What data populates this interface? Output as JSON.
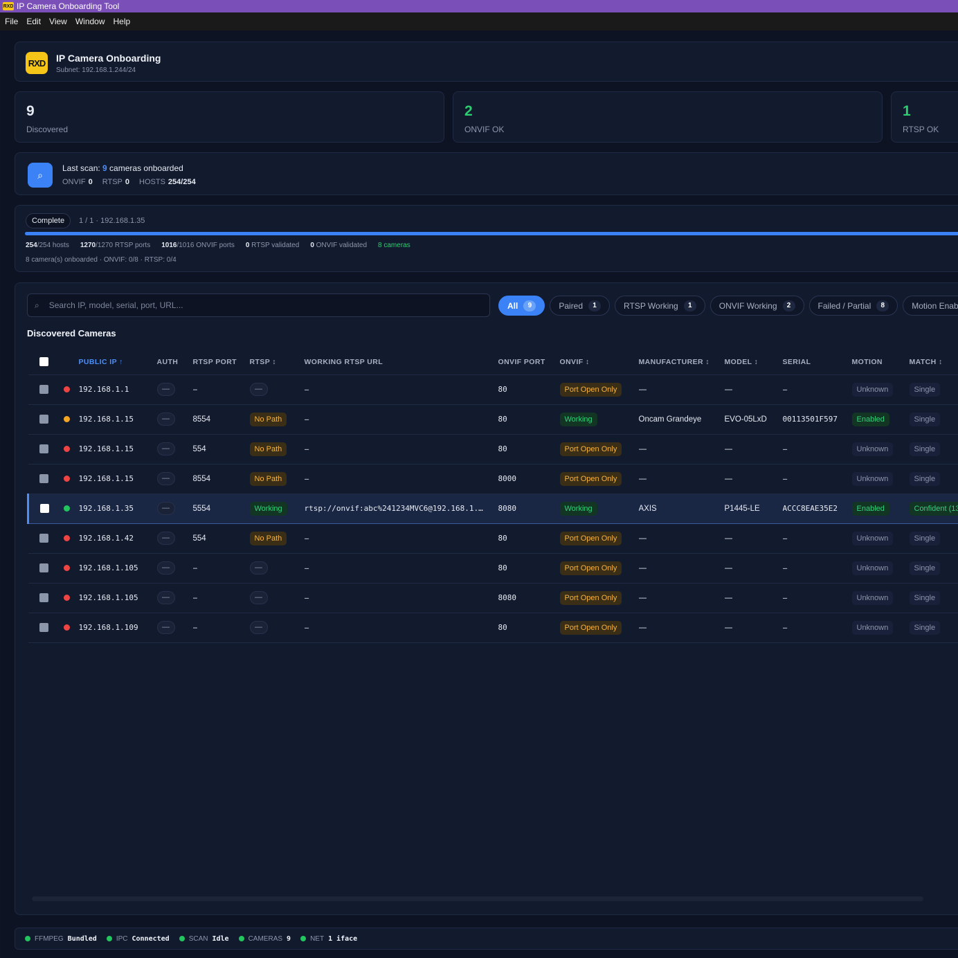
{
  "window": {
    "title": "IP Camera Onboarding Tool",
    "icon": "app-logo-icon"
  },
  "menu": [
    "File",
    "Edit",
    "View",
    "Window",
    "Help"
  ],
  "header": {
    "logo_text": "RXD",
    "title": "IP Camera Onboarding",
    "subtitle": "Subnet: 192.168.1.244/24"
  },
  "stats": [
    {
      "value": "9",
      "label": "Discovered"
    },
    {
      "value": "2",
      "label": "ONVIF OK"
    },
    {
      "value": "1",
      "label": "RTSP OK"
    }
  ],
  "last_scan": {
    "prefix": "Last scan: ",
    "count": "9",
    "suffix": " cameras onboarded",
    "onvif_label": "ONVIF",
    "onvif_value": "0",
    "rtsp_label": "RTSP",
    "rtsp_value": "0",
    "hosts_label": "HOSTS",
    "hosts_value": "254/254"
  },
  "progress": {
    "status": "Complete",
    "position": "1 / 1 · 192.168.1.35",
    "percent": 100,
    "hosts_done": "254",
    "hosts_rest": "/254 hosts",
    "rtsp_ports_done": "1270",
    "rtsp_ports_rest": "/1270 RTSP ports",
    "onvif_ports_done": "1016",
    "onvif_ports_rest": "/1016 ONVIF ports",
    "rtsp_validated_n": "0",
    "rtsp_validated_rest": " RTSP validated",
    "onvif_validated_n": "0",
    "onvif_validated_rest": " ONVIF validated",
    "cameras": "8 cameras",
    "footer": "8 camera(s) onboarded · ONVIF: 0/8 · RTSP: 0/4"
  },
  "search": {
    "placeholder": "Search IP, model, serial, port, URL..."
  },
  "filters": [
    {
      "label": "All",
      "count": "9"
    },
    {
      "label": "Paired",
      "count": "1"
    },
    {
      "label": "RTSP Working",
      "count": "1"
    },
    {
      "label": "ONVIF Working",
      "count": "2"
    },
    {
      "label": "Failed / Partial",
      "count": "8"
    },
    {
      "label": "Motion Enabled",
      "count": ""
    }
  ],
  "table": {
    "title": "Discovered Cameras",
    "columns": [
      "PUBLIC IP ↑",
      "AUTH",
      "RTSP PORT",
      "RTSP ↕",
      "WORKING RTSP URL",
      "ONVIF PORT",
      "ONVIF ↕",
      "MANUFACTURER ↕",
      "MODEL ↕",
      "SERIAL",
      "MOTION",
      "MATCH ↕"
    ],
    "rows": [
      {
        "status": "red",
        "ip": "192.168.1.1",
        "auth": "—",
        "rtsp_port": "–",
        "rtsp": "—",
        "rtsp_kind": "dash",
        "url": "–",
        "onvif_port": "80",
        "onvif": "Port Open Only",
        "onvif_kind": "amber",
        "manufacturer": "—",
        "model": "—",
        "serial": "–",
        "motion": "Unknown",
        "motion_kind": "gray",
        "match": "Single",
        "match_kind": "gray"
      },
      {
        "status": "amber",
        "ip": "192.168.1.15",
        "auth": "—",
        "rtsp_port": "8554",
        "rtsp": "No Path",
        "rtsp_kind": "amber",
        "url": "–",
        "onvif_port": "80",
        "onvif": "Working",
        "onvif_kind": "green",
        "manufacturer": "Oncam Grandeye",
        "model": "EVO-05LxD",
        "serial": "00113501F597",
        "motion": "Enabled",
        "motion_kind": "green",
        "match": "Single",
        "match_kind": "gray"
      },
      {
        "status": "red",
        "ip": "192.168.1.15",
        "auth": "—",
        "rtsp_port": "554",
        "rtsp": "No Path",
        "rtsp_kind": "amber",
        "url": "–",
        "onvif_port": "80",
        "onvif": "Port Open Only",
        "onvif_kind": "amber",
        "manufacturer": "—",
        "model": "—",
        "serial": "–",
        "motion": "Unknown",
        "motion_kind": "gray",
        "match": "Single",
        "match_kind": "gray"
      },
      {
        "status": "red",
        "ip": "192.168.1.15",
        "auth": "—",
        "rtsp_port": "8554",
        "rtsp": "No Path",
        "rtsp_kind": "amber",
        "url": "–",
        "onvif_port": "8000",
        "onvif": "Port Open Only",
        "onvif_kind": "amber",
        "manufacturer": "—",
        "model": "—",
        "serial": "–",
        "motion": "Unknown",
        "motion_kind": "gray",
        "match": "Single",
        "match_kind": "gray"
      },
      {
        "status": "green",
        "ip": "192.168.1.35",
        "auth": "—",
        "rtsp_port": "5554",
        "rtsp": "Working",
        "rtsp_kind": "green",
        "url": "rtsp://onvif:abc%241234MVC6@192.168.1.…",
        "onvif_port": "8080",
        "onvif": "Working",
        "onvif_kind": "green",
        "manufacturer": "AXIS",
        "model": "P1445-LE",
        "serial": "ACCC8EAE35E2",
        "motion": "Enabled",
        "motion_kind": "green",
        "match": "Confident (13",
        "match_kind": "green",
        "selected": true
      },
      {
        "status": "red",
        "ip": "192.168.1.42",
        "auth": "—",
        "rtsp_port": "554",
        "rtsp": "No Path",
        "rtsp_kind": "amber",
        "url": "–",
        "onvif_port": "80",
        "onvif": "Port Open Only",
        "onvif_kind": "amber",
        "manufacturer": "—",
        "model": "—",
        "serial": "–",
        "motion": "Unknown",
        "motion_kind": "gray",
        "match": "Single",
        "match_kind": "gray"
      },
      {
        "status": "red",
        "ip": "192.168.1.105",
        "auth": "—",
        "rtsp_port": "–",
        "rtsp": "—",
        "rtsp_kind": "dash",
        "url": "–",
        "onvif_port": "80",
        "onvif": "Port Open Only",
        "onvif_kind": "amber",
        "manufacturer": "—",
        "model": "—",
        "serial": "–",
        "motion": "Unknown",
        "motion_kind": "gray",
        "match": "Single",
        "match_kind": "gray"
      },
      {
        "status": "red",
        "ip": "192.168.1.105",
        "auth": "—",
        "rtsp_port": "–",
        "rtsp": "—",
        "rtsp_kind": "dash",
        "url": "–",
        "onvif_port": "8080",
        "onvif": "Port Open Only",
        "onvif_kind": "amber",
        "manufacturer": "—",
        "model": "—",
        "serial": "–",
        "motion": "Unknown",
        "motion_kind": "gray",
        "match": "Single",
        "match_kind": "gray"
      },
      {
        "status": "red",
        "ip": "192.168.1.109",
        "auth": "—",
        "rtsp_port": "–",
        "rtsp": "—",
        "rtsp_kind": "dash",
        "url": "–",
        "onvif_port": "80",
        "onvif": "Port Open Only",
        "onvif_kind": "amber",
        "manufacturer": "—",
        "model": "—",
        "serial": "–",
        "motion": "Unknown",
        "motion_kind": "gray",
        "match": "Single",
        "match_kind": "gray"
      }
    ]
  },
  "statusbar": [
    {
      "label": "FFMPEG",
      "value": "Bundled"
    },
    {
      "label": "IPC",
      "value": "Connected"
    },
    {
      "label": "SCAN",
      "value": "Idle"
    },
    {
      "label": "CAMERAS",
      "value": "9"
    },
    {
      "label": "NET",
      "value": "1 iface"
    }
  ],
  "colors": {
    "accent": "#3b82f6",
    "ok": "#2ecc71",
    "warn": "#f5b342",
    "error": "#ef4444",
    "titlebar": "#7a4fb8"
  }
}
